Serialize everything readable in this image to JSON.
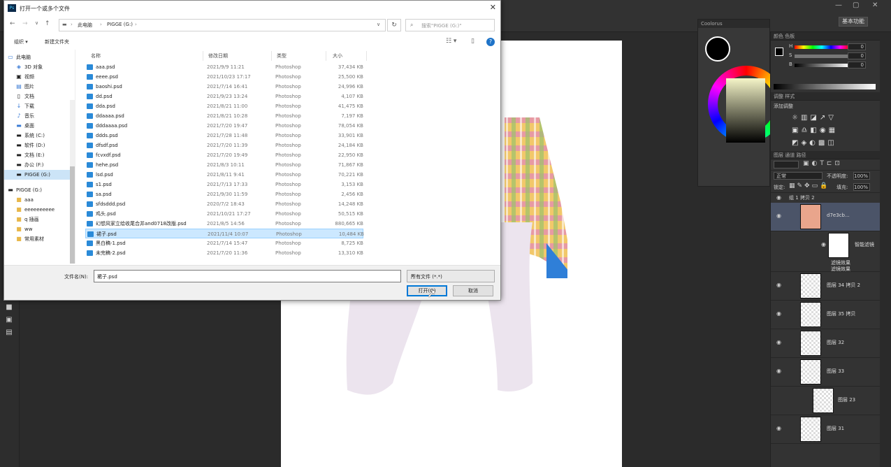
{
  "dialog": {
    "title": "打开一个或多个文件",
    "close": "✕",
    "address": {
      "segments": [
        "此电脑",
        "PIGGE (G:)"
      ]
    },
    "search_placeholder": "搜索\"PIGGE (G:)\"",
    "toolbar": {
      "organize": "组织 ▾",
      "new_folder": "新建文件夹"
    },
    "nav": [
      {
        "label": "此电脑",
        "icon": "computer-icon"
      },
      {
        "label": "3D 对象",
        "icon": "cube-icon"
      },
      {
        "label": "视频",
        "icon": "video-icon"
      },
      {
        "label": "图片",
        "icon": "picture-icon"
      },
      {
        "label": "文档",
        "icon": "document-icon"
      },
      {
        "label": "下载",
        "icon": "download-icon"
      },
      {
        "label": "音乐",
        "icon": "music-icon"
      },
      {
        "label": "桌面",
        "icon": "desktop-icon"
      },
      {
        "label": "系统 (C:)",
        "icon": "drive-icon"
      },
      {
        "label": "软件 (D:)",
        "icon": "drive-icon"
      },
      {
        "label": "文档 (E:)",
        "icon": "drive-icon"
      },
      {
        "label": "办公 (F:)",
        "icon": "drive-icon"
      },
      {
        "label": "PIGGE (G:)",
        "icon": "drive-icon",
        "selected": true
      },
      {
        "label": "PIGGE (G:)",
        "icon": "drive-icon"
      },
      {
        "label": "aaa",
        "icon": "folder-icon"
      },
      {
        "label": "eeeeeeeeee",
        "icon": "folder-icon"
      },
      {
        "label": "q 插画",
        "icon": "folder-icon"
      },
      {
        "label": "ww",
        "icon": "folder-icon"
      },
      {
        "label": "常用素材",
        "icon": "folder-icon"
      }
    ],
    "columns": {
      "name": "名称",
      "date": "修改日期",
      "type": "类型",
      "size": "大小"
    },
    "files": [
      {
        "name": "aaa.psd",
        "date": "2021/9/9 11:21",
        "type": "Photoshop",
        "size": "37,434 KB"
      },
      {
        "name": "eeee.psd",
        "date": "2021/10/23 17:17",
        "type": "Photoshop",
        "size": "25,500 KB"
      },
      {
        "name": "baoshi.psd",
        "date": "2021/7/14 16:41",
        "type": "Photoshop",
        "size": "24,996 KB"
      },
      {
        "name": "dd.psd",
        "date": "2021/9/23 13:24",
        "type": "Photoshop",
        "size": "4,107 KB"
      },
      {
        "name": "dda.psd",
        "date": "2021/8/21 11:00",
        "type": "Photoshop",
        "size": "41,475 KB"
      },
      {
        "name": "ddaaaa.psd",
        "date": "2021/8/21 10:28",
        "type": "Photoshop",
        "size": "7,197 KB"
      },
      {
        "name": "dddaaaa.psd",
        "date": "2021/7/20 19:47",
        "type": "Photoshop",
        "size": "78,054 KB"
      },
      {
        "name": "ddds.psd",
        "date": "2021/7/28 11:48",
        "type": "Photoshop",
        "size": "33,901 KB"
      },
      {
        "name": "dfsdf.psd",
        "date": "2021/7/20 11:39",
        "type": "Photoshop",
        "size": "24,184 KB"
      },
      {
        "name": "fcvxdf.psd",
        "date": "2021/7/20 19:49",
        "type": "Photoshop",
        "size": "22,950 KB"
      },
      {
        "name": "hehe.psd",
        "date": "2021/8/3 10:11",
        "type": "Photoshop",
        "size": "71,867 KB"
      },
      {
        "name": "lsd.psd",
        "date": "2021/8/11 9:41",
        "type": "Photoshop",
        "size": "70,221 KB"
      },
      {
        "name": "s1.psd",
        "date": "2021/7/13 17:33",
        "type": "Photoshop",
        "size": "3,153 KB"
      },
      {
        "name": "sa.psd",
        "date": "2021/9/30 11:59",
        "type": "Photoshop",
        "size": "2,456 KB"
      },
      {
        "name": "sfdsddd.psd",
        "date": "2020/7/2 18:43",
        "type": "Photoshop",
        "size": "14,248 KB"
      },
      {
        "name": "鸡头.psd",
        "date": "2021/10/21 17:27",
        "type": "Photoshop",
        "size": "50,515 KB"
      },
      {
        "name": "幻想风家立绘收尾合并and0718改版.psd",
        "date": "2021/8/5 14:56",
        "type": "Photoshop",
        "size": "880,665 KB"
      },
      {
        "name": "裙子.psd",
        "date": "2021/11/4 10:07",
        "type": "Photoshop",
        "size": "10,484 KB",
        "selected": true
      },
      {
        "name": "黑白稿-1.psd",
        "date": "2021/7/14 15:47",
        "type": "Photoshop",
        "size": "8,725 KB"
      },
      {
        "name": "未完稿-2.psd",
        "date": "2021/7/20 11:36",
        "type": "Photoshop",
        "size": "13,310 KB"
      }
    ],
    "filename_label": "文件名(N):",
    "filename_value": "裙子.psd",
    "filetype_value": "所有文件 (*.*)",
    "open_button": "打开(O)",
    "cancel_button": "取消"
  },
  "photoshop": {
    "workspace_button": "基本功能",
    "color_panel_title": "Coolorus",
    "props_tabs": "颜色  色板",
    "adjust_tabs": "调整  样式",
    "adjust_label": "添加调整",
    "layers_tabs": "图层  通道  路径",
    "blend_mode": "正常",
    "opacity_label": "不透明度:",
    "opacity_value": "100%",
    "lock_label": "锁定:",
    "fill_label": "填充:",
    "fill_value": "100%",
    "sliders": [
      {
        "label": "H",
        "value": "0"
      },
      {
        "label": "S",
        "value": "0"
      },
      {
        "label": "B",
        "value": "0"
      }
    ],
    "group_name": "组 1 拷贝 2",
    "layers": [
      {
        "name": "d7e3cb...",
        "selected": true
      },
      {
        "name": "智能滤镜"
      },
      {
        "name": "图层 34 拷贝 2"
      },
      {
        "name": "图层 35 拷贝"
      },
      {
        "name": "图层 32"
      },
      {
        "name": "图层 33"
      },
      {
        "name": "图层 23"
      },
      {
        "name": "图层 31"
      }
    ],
    "filter_items": [
      "滤镜效果",
      "滤镜效果"
    ]
  }
}
